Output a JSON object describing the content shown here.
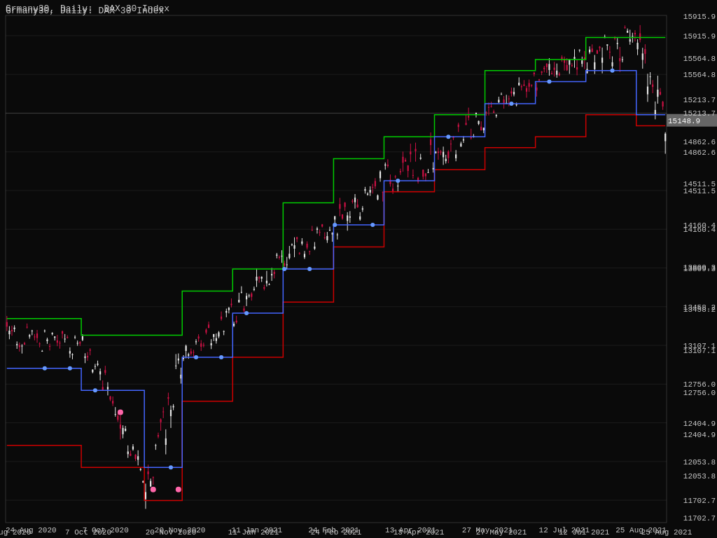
{
  "chart": {
    "title": "Grmany30, Daily:  DAX 30 Index",
    "price_current": "15148.9",
    "price_axis": [
      "15915.9",
      "15564.8",
      "15213.7",
      "14862.6",
      "14511.5",
      "14160.4",
      "13809.3",
      "13458.2",
      "13107.1",
      "12756.0",
      "12404.9",
      "12053.8",
      "11702.7"
    ],
    "time_axis": [
      "24 Aug 2020",
      "7 Oct 2020",
      "20 Nov 2020",
      "11 Jan 2021",
      "24 Feb 2021",
      "13 Apr 2021",
      "27 May 2021",
      "12 Jul 2021",
      "25 Aug 2021"
    ],
    "colors": {
      "background": "#0a0a0a",
      "green_line": "#00cc00",
      "red_line": "#cc0000",
      "blue_line": "#3366ff",
      "candle_up": "#ffffff",
      "candle_down": "#cc0033",
      "dot": "#6699ff",
      "grid": "rgba(80,80,80,0.3)"
    }
  }
}
